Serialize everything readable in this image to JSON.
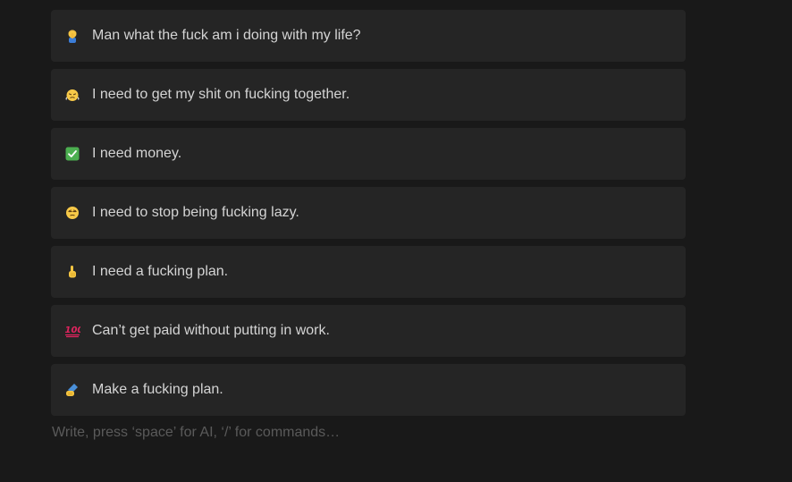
{
  "callouts": [
    {
      "icon": "man-facepalming-icon",
      "text": "Man what the fuck am i doing with my life?"
    },
    {
      "icon": "face-with-steam-icon",
      "text": "I need to get my shit on fucking together."
    },
    {
      "icon": "check-mark-button-icon",
      "text": "I need money."
    },
    {
      "icon": "unamused-face-icon",
      "text": "I need to stop being fucking lazy."
    },
    {
      "icon": "index-pointing-up-icon",
      "text": "I need a fucking plan."
    },
    {
      "icon": "hundred-points-icon",
      "text": "Can’t get paid without putting in work."
    },
    {
      "icon": "writing-hand-icon",
      "text": "Make a fucking plan."
    }
  ],
  "editor": {
    "placeholder": "Write, press ‘space’ for AI, ‘/’ for commands…"
  },
  "colors": {
    "background": "#191919",
    "callout_background": "#252525",
    "text": "#d4d4d4",
    "placeholder": "#5a5a5a",
    "check_green": "#4caf50",
    "hundred_red": "#e0245e"
  }
}
